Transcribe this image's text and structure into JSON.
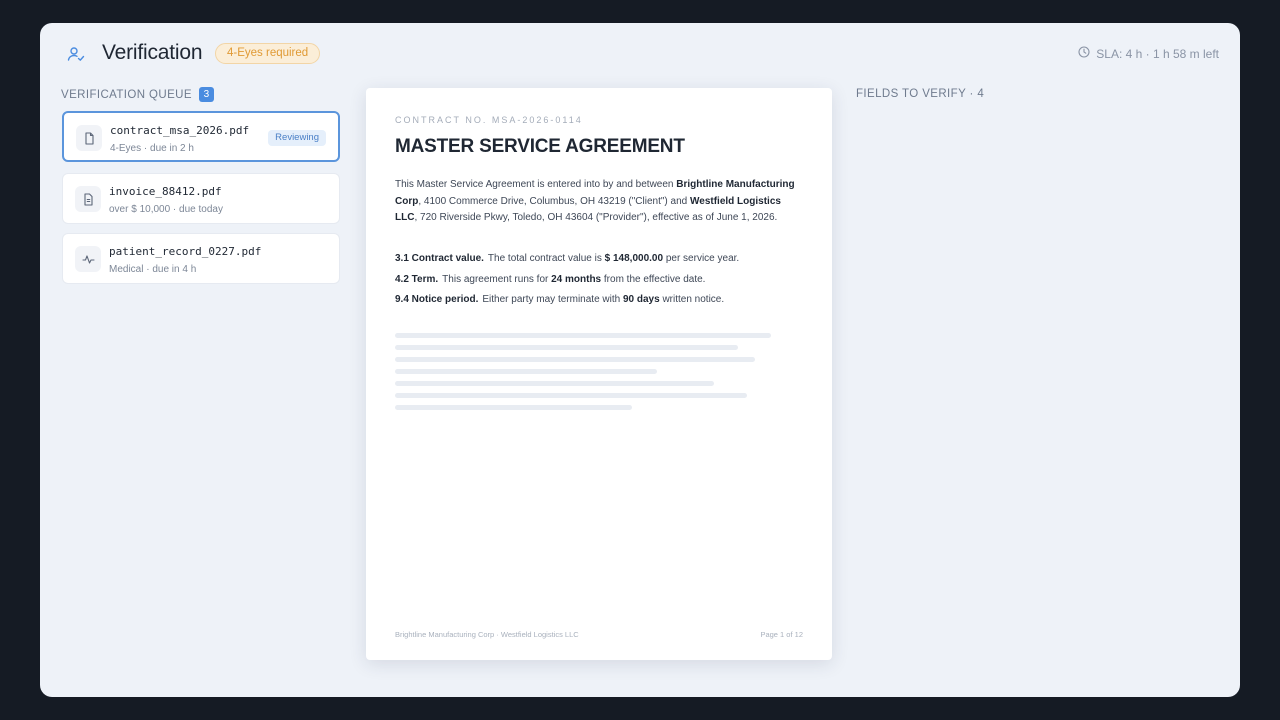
{
  "header": {
    "title": "Verification",
    "badge": "4-Eyes required",
    "sla": "SLA: 4 h · 1 h 58 m left"
  },
  "queue": {
    "title": "VERIFICATION QUEUE",
    "count": "3",
    "items": [
      {
        "name": "contract_msa_2026.pdf",
        "sub": "4-Eyes · due in 2 h",
        "badge": "Reviewing",
        "icon": "document-icon"
      },
      {
        "name": "invoice_88412.pdf",
        "sub": "over $ 10,000 · due today",
        "icon": "invoice-icon"
      },
      {
        "name": "patient_record_0227.pdf",
        "sub": "Medical · due in 4 h",
        "icon": "pulse-icon"
      }
    ]
  },
  "document": {
    "contract_no": "CONTRACT NO. MSA-2026-0114",
    "title": "MASTER SERVICE AGREEMENT",
    "intro": {
      "p1": "This Master Service Agreement is entered into by and between ",
      "party1": "Brightline Manufacturing Corp",
      "p2": ", 4100 Commerce Drive, Columbus, OH 43219 (\"Client\") and ",
      "party2": "Westfield Logistics LLC",
      "p3": ", 720 Riverside Pkwy, Toledo, OH 43604 (\"Provider\"), effective as of June 1, 2026."
    },
    "clauses": [
      {
        "title": "3.1 Contract value.",
        "pre": "The total contract value is ",
        "value": "$ 148,000.00",
        "post": " per service year."
      },
      {
        "title": "4.2 Term.",
        "pre": "This agreement runs for ",
        "value": "24 months",
        "post": " from the effective date."
      },
      {
        "title": "9.4 Notice period.",
        "pre": "Either party may terminate with ",
        "value": "90 days",
        "post": " written notice."
      }
    ],
    "footer_left": "Brightline Manufacturing Corp · Westfield Logistics LLC",
    "footer_right": "Page 1 of 12"
  },
  "fields": {
    "title": "FIELDS TO VERIFY · 4"
  },
  "colors": {
    "accent": "#4a8ce0",
    "warning": "#e09a35",
    "window_bg": "#eef2f8",
    "outer_bg": "#151b24"
  }
}
